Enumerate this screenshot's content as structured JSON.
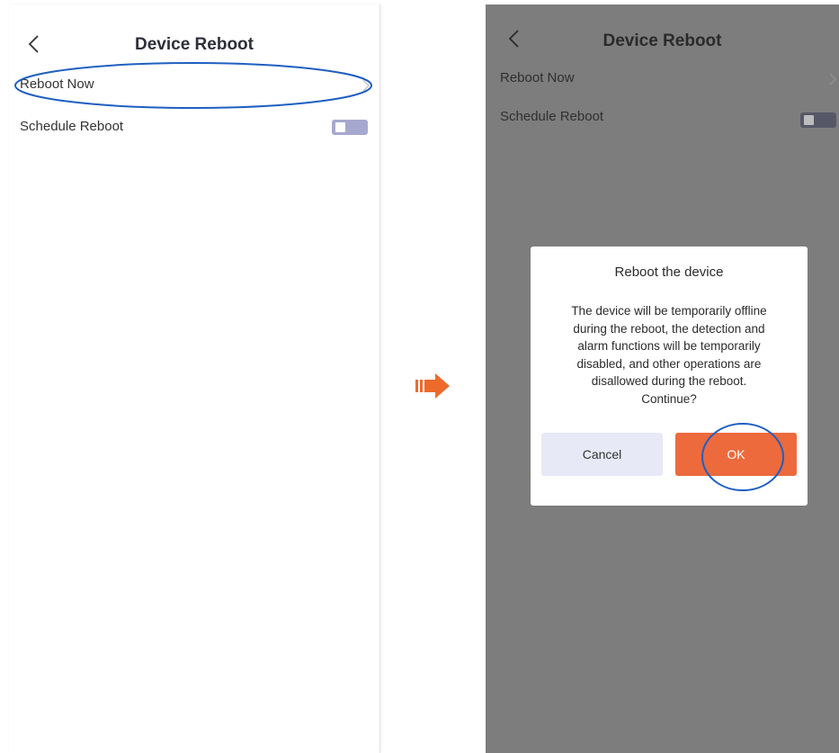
{
  "left_screen": {
    "nav": {
      "title": "Device Reboot"
    },
    "rows": [
      {
        "label": "Reboot Now"
      },
      {
        "label": "Schedule Reboot"
      }
    ],
    "schedule_toggle_on": false
  },
  "right_screen": {
    "nav": {
      "title": "Device Reboot"
    },
    "rows": [
      {
        "label": "Reboot Now"
      },
      {
        "label": "Schedule Reboot"
      }
    ],
    "dialog": {
      "title": "Reboot the device",
      "message": "The device will be temporarily offline\nduring the reboot, the detection and\nalarm functions will be temporarily\ndisabled, and other operations are\ndisallowed during the reboot.\nContinue?",
      "cancel_label": "Cancel",
      "ok_label": "OK"
    }
  },
  "colors": {
    "highlight": "#1f5fc0",
    "arrow": "#ee6a2a",
    "ok_button": "#ed6a3d",
    "cancel_button": "#e7e9f7",
    "toggle": "#a7a8cf"
  },
  "icons": [
    "back-chevron-icon",
    "chevron-right-icon",
    "arrow-right-icon"
  ]
}
